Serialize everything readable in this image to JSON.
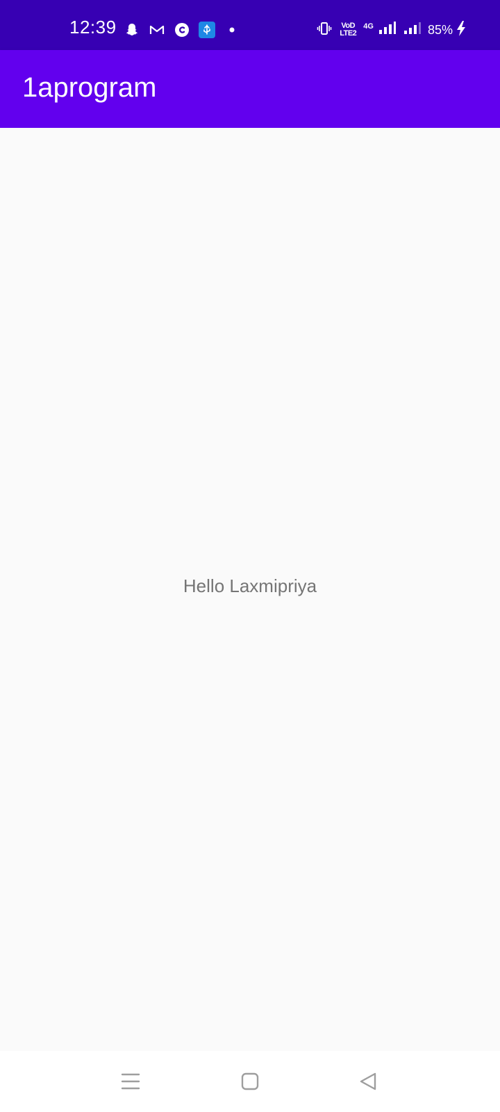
{
  "status_bar": {
    "time": "12:39",
    "left_icons": [
      "snapchat-icon",
      "gmail-icon",
      "copyright-app-icon",
      "usb-icon",
      "notification-dot-icon"
    ],
    "vibrate_icon": "vibrate-icon",
    "volte_top": "VoD",
    "volte_bottom": "LTE2",
    "network_type": "4G",
    "battery_percent": "85%",
    "charging_icon": "charging-bolt-icon",
    "background_color": "#3700B3"
  },
  "app_bar": {
    "title": "1aprogram",
    "background_color": "#6200EE"
  },
  "main": {
    "greeting": "Hello Laxmipriya",
    "text_color": "#757575",
    "background_color": "#FAFAFA"
  },
  "nav_bar": {
    "buttons": [
      "menu-icon",
      "home-icon",
      "back-icon"
    ]
  }
}
